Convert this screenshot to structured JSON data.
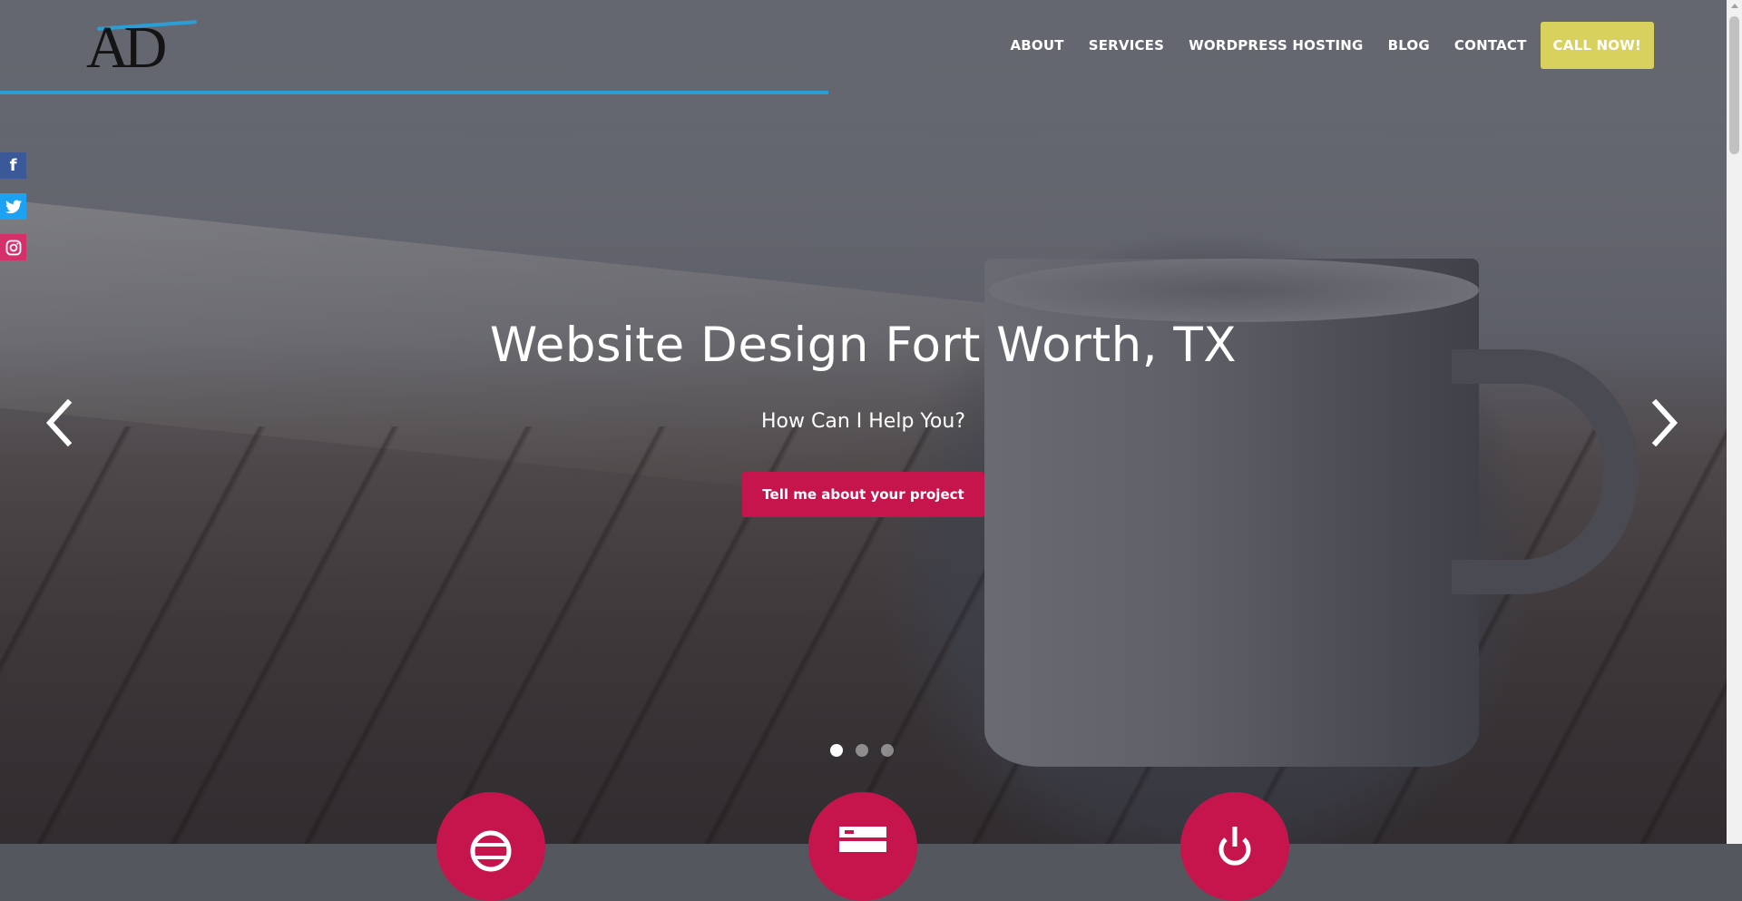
{
  "header": {
    "logo_text": "AD",
    "nav": [
      {
        "label": "ABOUT"
      },
      {
        "label": "SERVICES"
      },
      {
        "label": "WORDPRESS HOSTING"
      },
      {
        "label": "BLOG"
      },
      {
        "label": "CONTACT"
      }
    ],
    "call_label": "CALL NOW!"
  },
  "social": {
    "facebook": "f",
    "twitter": "t",
    "instagram": "◎"
  },
  "slider": {
    "title": "Website Design Fort Worth, TX",
    "subtitle": "How Can I Help You?",
    "cta_label": "Tell me about your project",
    "prev_icon": "chevron-left-icon",
    "next_icon": "chevron-right-icon",
    "slide_count": 3,
    "active_slide": 1
  },
  "features": [
    {
      "icon": "globe-icon"
    },
    {
      "icon": "server-icon"
    },
    {
      "icon": "power-icon"
    }
  ],
  "colors": {
    "accent_blue": "#2a9fd6",
    "cta_red": "#c6154d",
    "call_yellow": "#d9d15e"
  }
}
